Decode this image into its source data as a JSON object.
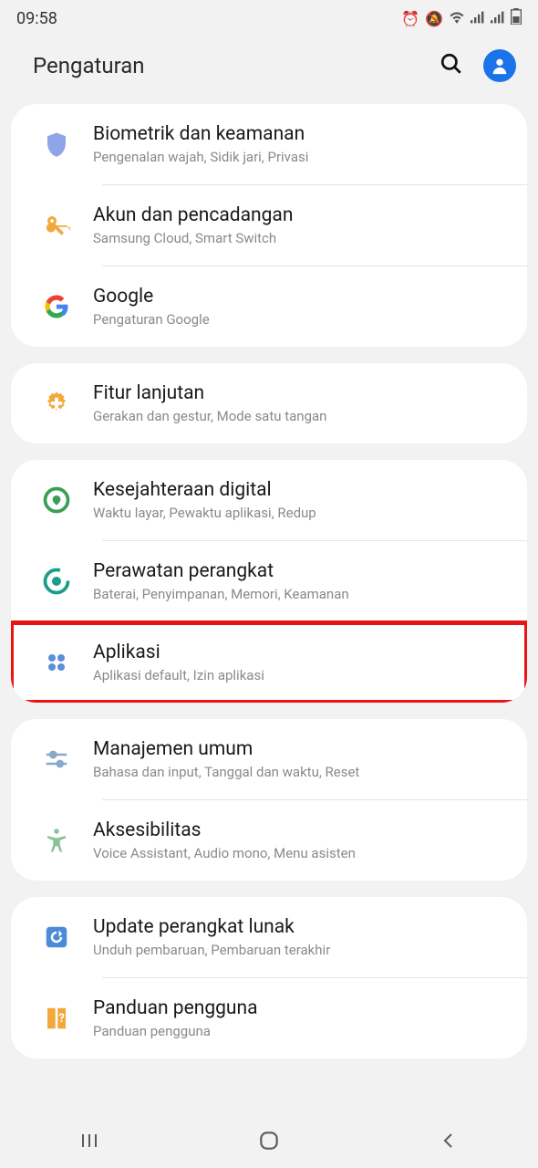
{
  "status": {
    "time": "09:58"
  },
  "header": {
    "title": "Pengaturan"
  },
  "groups": [
    {
      "items": [
        {
          "key": "biometrics",
          "title": "Biometrik dan keamanan",
          "subtitle": "Pengenalan wajah, Sidik jari, Privasi"
        },
        {
          "key": "accounts",
          "title": "Akun dan pencadangan",
          "subtitle": "Samsung Cloud, Smart Switch"
        },
        {
          "key": "google",
          "title": "Google",
          "subtitle": "Pengaturan Google"
        }
      ]
    },
    {
      "items": [
        {
          "key": "advanced",
          "title": "Fitur lanjutan",
          "subtitle": "Gerakan dan gestur, Mode satu tangan"
        }
      ]
    },
    {
      "items": [
        {
          "key": "wellbeing",
          "title": "Kesejahteraan digital",
          "subtitle": "Waktu layar, Pewaktu aplikasi, Redup"
        },
        {
          "key": "devicecare",
          "title": "Perawatan perangkat",
          "subtitle": "Baterai, Penyimpanan, Memori, Keamanan"
        },
        {
          "key": "apps",
          "title": "Aplikasi",
          "subtitle": "Aplikasi default, Izin aplikasi",
          "highlighted": true
        }
      ]
    },
    {
      "items": [
        {
          "key": "general",
          "title": "Manajemen umum",
          "subtitle": "Bahasa dan input, Tanggal dan waktu, Reset"
        },
        {
          "key": "accessibility",
          "title": "Aksesibilitas",
          "subtitle": "Voice Assistant, Audio mono, Menu asisten"
        }
      ]
    },
    {
      "items": [
        {
          "key": "update",
          "title": "Update perangkat lunak",
          "subtitle": "Unduh pembaruan, Pembaruan terakhir"
        },
        {
          "key": "guide",
          "title": "Panduan pengguna",
          "subtitle": "Panduan pengguna"
        }
      ]
    }
  ]
}
